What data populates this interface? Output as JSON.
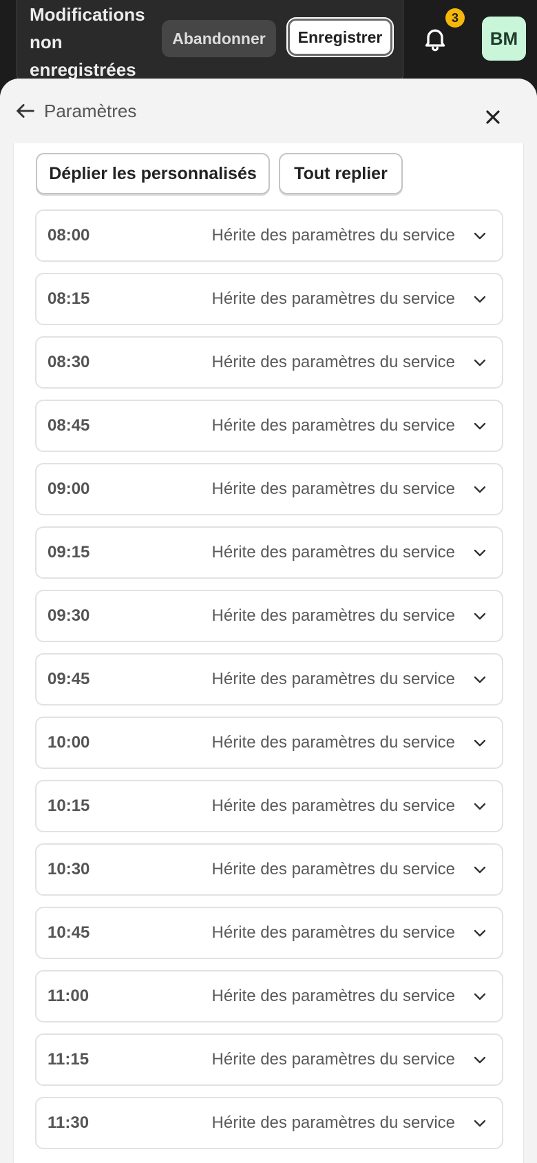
{
  "unsaved_bar": {
    "message": "Modifications non enregistrées",
    "discard_label": "Abandonner",
    "save_label": "Enregistrer"
  },
  "notifications": {
    "count": "3"
  },
  "user": {
    "initials": "BM"
  },
  "sheet": {
    "title": "Paramètres"
  },
  "actions": {
    "expand_custom_label": "Déplier les personnalisés",
    "collapse_all_label": "Tout replier"
  },
  "slots": [
    {
      "time": "08:00",
      "status": "Hérite des paramètres du service"
    },
    {
      "time": "08:15",
      "status": "Hérite des paramètres du service"
    },
    {
      "time": "08:30",
      "status": "Hérite des paramètres du service"
    },
    {
      "time": "08:45",
      "status": "Hérite des paramètres du service"
    },
    {
      "time": "09:00",
      "status": "Hérite des paramètres du service"
    },
    {
      "time": "09:15",
      "status": "Hérite des paramètres du service"
    },
    {
      "time": "09:30",
      "status": "Hérite des paramètres du service"
    },
    {
      "time": "09:45",
      "status": "Hérite des paramètres du service"
    },
    {
      "time": "10:00",
      "status": "Hérite des paramètres du service"
    },
    {
      "time": "10:15",
      "status": "Hérite des paramètres du service"
    },
    {
      "time": "10:30",
      "status": "Hérite des paramètres du service"
    },
    {
      "time": "10:45",
      "status": "Hérite des paramètres du service"
    },
    {
      "time": "11:00",
      "status": "Hérite des paramètres du service"
    },
    {
      "time": "11:15",
      "status": "Hérite des paramètres du service"
    },
    {
      "time": "11:30",
      "status": "Hérite des paramètres du service"
    }
  ],
  "colors": {
    "topbar_bg": "#1c1c1c",
    "badge": "#f5b80a",
    "avatar_bg": "#c9f6d9"
  }
}
